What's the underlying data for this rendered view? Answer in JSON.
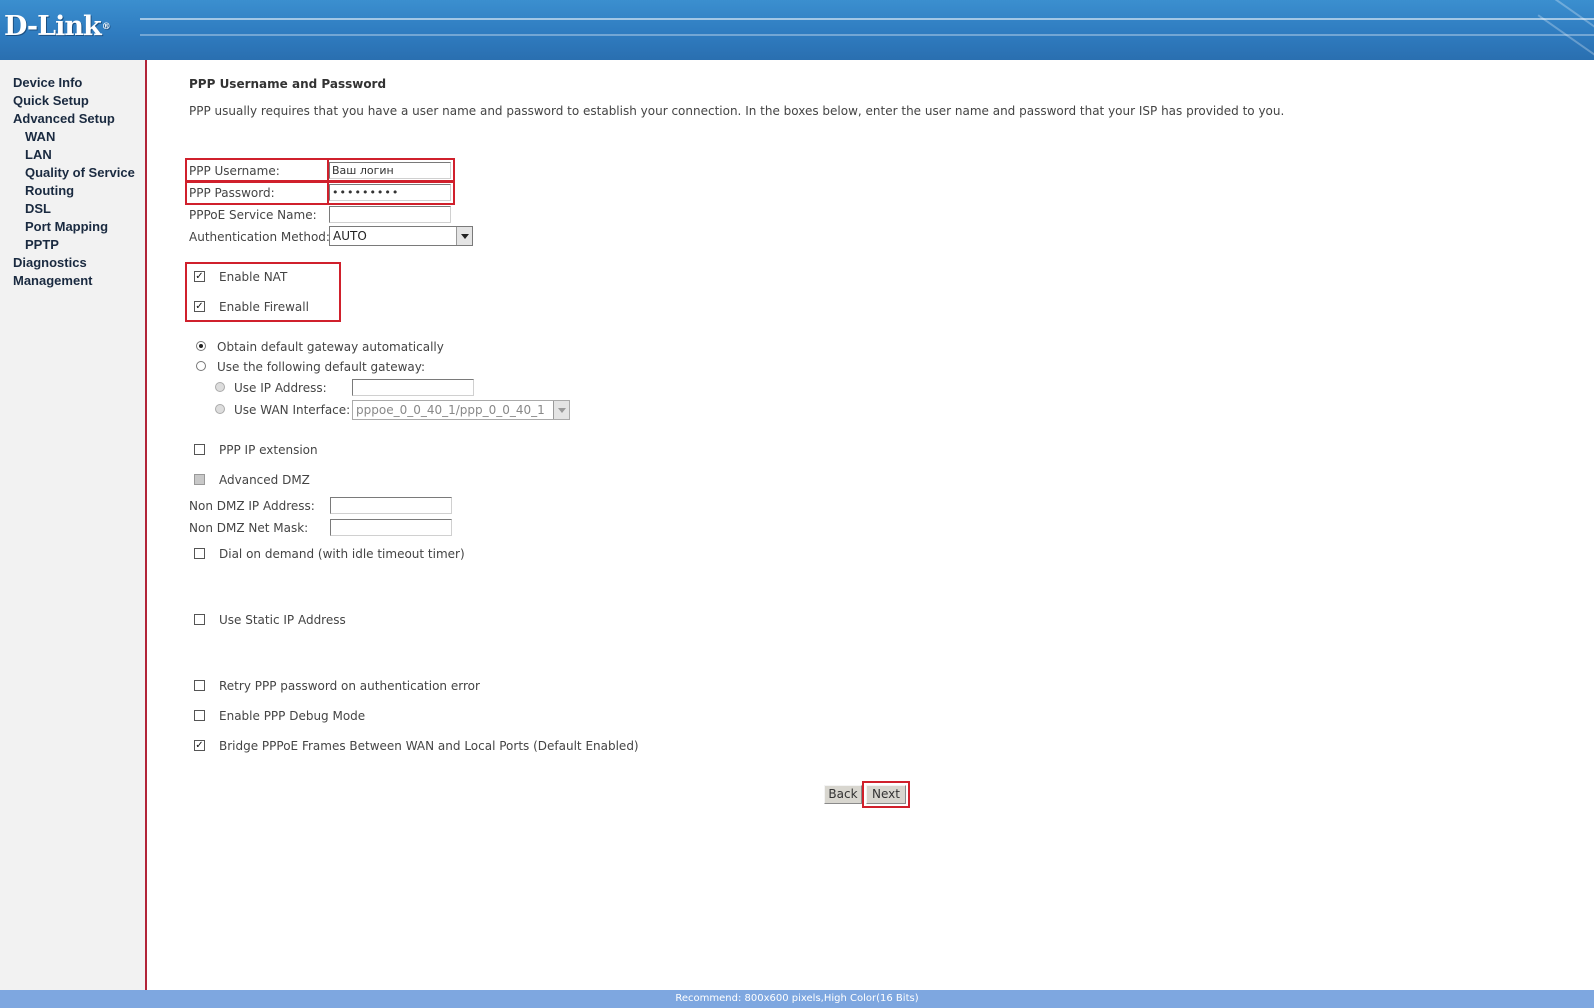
{
  "brand": {
    "logo_text": "D-Link",
    "registered_mark": "®"
  },
  "sidebar": {
    "items": [
      {
        "label": "Device Info"
      },
      {
        "label": "Quick Setup"
      },
      {
        "label": "Advanced Setup"
      },
      {
        "label": "WAN"
      },
      {
        "label": "LAN"
      },
      {
        "label": "Quality of Service"
      },
      {
        "label": "Routing"
      },
      {
        "label": "DSL"
      },
      {
        "label": "Port Mapping"
      },
      {
        "label": "PPTP"
      },
      {
        "label": "Diagnostics"
      },
      {
        "label": "Management"
      }
    ]
  },
  "main": {
    "title": "PPP Username and Password",
    "description": "PPP usually requires that you have a user name and password to establish your connection. In the boxes below, enter the user name and password that your ISP has provided to you.",
    "ppp_username": {
      "label": "PPP Username:",
      "value": "Ваш логин"
    },
    "ppp_password": {
      "label": "PPP Password:",
      "value": "•••••••••"
    },
    "pppoe_service_name": {
      "label": "PPPoE Service Name:",
      "value": ""
    },
    "auth_method": {
      "label": "Authentication Method:",
      "value": "AUTO"
    },
    "enable_nat": {
      "label": "Enable NAT",
      "checked": true
    },
    "enable_firewall": {
      "label": "Enable Firewall",
      "checked": true
    },
    "gateway": {
      "obtain_auto_label": "Obtain default gateway automatically",
      "use_following_label": "Use the following default gateway:",
      "use_ip_label": "Use IP Address:",
      "use_ip_value": "",
      "use_wan_label": "Use WAN Interface:",
      "use_wan_value": "pppoe_0_0_40_1/ppp_0_0_40_1"
    },
    "ppp_ip_extension": {
      "label": "PPP IP extension",
      "checked": false
    },
    "advanced_dmz": {
      "label": "Advanced DMZ",
      "checked": false
    },
    "non_dmz_ip": {
      "label": "Non DMZ IP Address:",
      "value": ""
    },
    "non_dmz_mask": {
      "label": "Non DMZ Net Mask:",
      "value": ""
    },
    "dial_on_demand": {
      "label": "Dial on demand (with idle timeout timer)",
      "checked": false
    },
    "use_static_ip": {
      "label": "Use Static IP Address",
      "checked": false
    },
    "retry_ppp": {
      "label": "Retry PPP password on authentication error",
      "checked": false
    },
    "ppp_debug": {
      "label": "Enable PPP Debug Mode",
      "checked": false
    },
    "bridge_pppoe": {
      "label": "Bridge PPPoE Frames Between WAN and Local Ports (Default Enabled)",
      "checked": true
    },
    "back_label": "Back",
    "next_label": "Next"
  },
  "footer": {
    "text": "Recommend: 800x600 pixels,High Color(16 Bits)"
  },
  "colors": {
    "header": "#2f7cc0",
    "highlight": "#d0202c",
    "sidebar_border": "#b22438",
    "footer": "#7ea7e0"
  }
}
